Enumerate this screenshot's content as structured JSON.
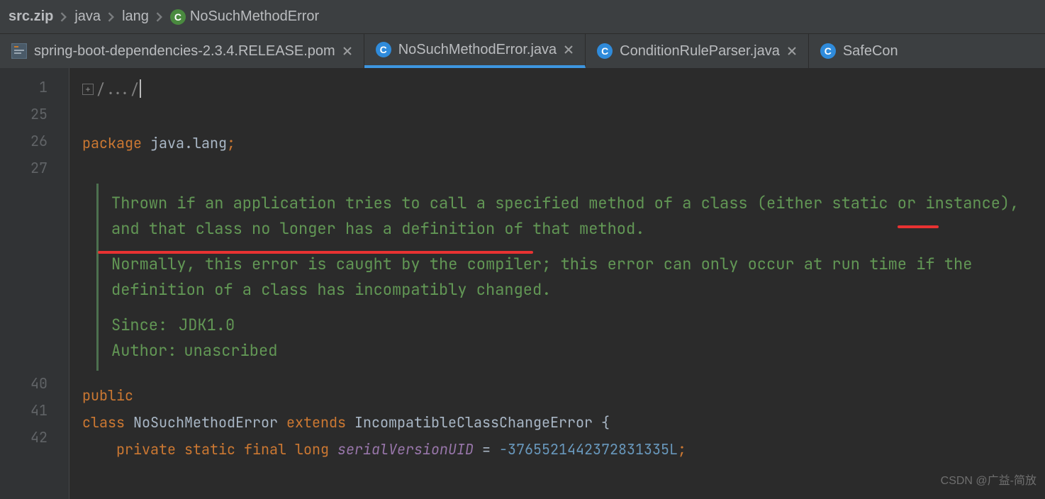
{
  "breadcrumbs": {
    "items": [
      "src.zip",
      "java",
      "lang",
      "NoSuchMethodError"
    ],
    "last_icon_letter": "C"
  },
  "tabs": [
    {
      "kind": "pom",
      "label": "spring-boot-dependencies-2.3.4.RELEASE.pom",
      "active": false
    },
    {
      "kind": "class",
      "icon": "C",
      "label": "NoSuchMethodError.java",
      "active": true
    },
    {
      "kind": "class",
      "icon": "C",
      "label": "ConditionRuleParser.java",
      "active": false
    },
    {
      "kind": "class",
      "icon": "C",
      "label": "SafeCon",
      "active": false,
      "truncated": true
    }
  ],
  "gutter": [
    "1",
    "25",
    "26",
    "27",
    "",
    "",
    "",
    "",
    "",
    "",
    "",
    "",
    "40",
    "41",
    "42"
  ],
  "fold_text": "/.../",
  "code": {
    "package_kw": "package",
    "package_name": "java.lang",
    "doc_p1": "Thrown if an application tries to call a specified method of a class (either static or instance), and that class no longer has a definition of that method.",
    "doc_p2": "Normally, this error is caught by the compiler; this error can only occur at run time if the definition of a class has incompatibly changed.",
    "doc_since_label": "Since:",
    "doc_since_value": "JDK1.0",
    "doc_author_label": "Author:",
    "doc_author_value": "unascribed",
    "public_kw": "public",
    "class_kw": "class",
    "class_name": "NoSuchMethodError",
    "extends_kw": "extends",
    "super_name": "IncompatibleClassChangeError",
    "brace_open": "{",
    "private_kw": "private",
    "static_kw": "static",
    "final_kw": "final",
    "long_kw": "long",
    "field_name": "serialVersionUID",
    "equals": "=",
    "field_value": "-3765521442372831335L",
    "semi": ";"
  },
  "watermark": "CSDN @广益-简放"
}
